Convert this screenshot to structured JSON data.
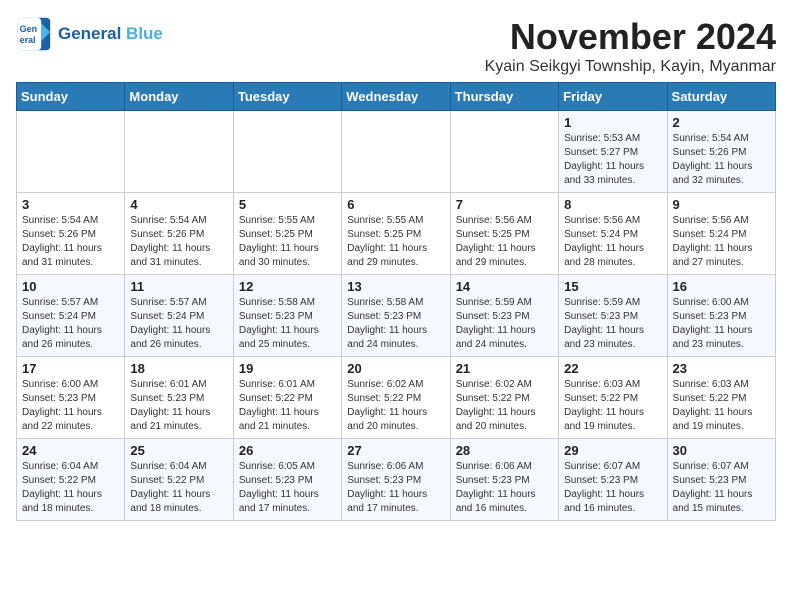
{
  "header": {
    "logo_line1": "General",
    "logo_line2": "Blue",
    "month_year": "November 2024",
    "location": "Kyain Seikgyi Township, Kayin, Myanmar"
  },
  "weekdays": [
    "Sunday",
    "Monday",
    "Tuesday",
    "Wednesday",
    "Thursday",
    "Friday",
    "Saturday"
  ],
  "weeks": [
    [
      {
        "day": "",
        "sunrise": "",
        "sunset": "",
        "daylight": ""
      },
      {
        "day": "",
        "sunrise": "",
        "sunset": "",
        "daylight": ""
      },
      {
        "day": "",
        "sunrise": "",
        "sunset": "",
        "daylight": ""
      },
      {
        "day": "",
        "sunrise": "",
        "sunset": "",
        "daylight": ""
      },
      {
        "day": "",
        "sunrise": "",
        "sunset": "",
        "daylight": ""
      },
      {
        "day": "1",
        "sunrise": "Sunrise: 5:53 AM",
        "sunset": "Sunset: 5:27 PM",
        "daylight": "Daylight: 11 hours and 33 minutes."
      },
      {
        "day": "2",
        "sunrise": "Sunrise: 5:54 AM",
        "sunset": "Sunset: 5:26 PM",
        "daylight": "Daylight: 11 hours and 32 minutes."
      }
    ],
    [
      {
        "day": "3",
        "sunrise": "Sunrise: 5:54 AM",
        "sunset": "Sunset: 5:26 PM",
        "daylight": "Daylight: 11 hours and 31 minutes."
      },
      {
        "day": "4",
        "sunrise": "Sunrise: 5:54 AM",
        "sunset": "Sunset: 5:26 PM",
        "daylight": "Daylight: 11 hours and 31 minutes."
      },
      {
        "day": "5",
        "sunrise": "Sunrise: 5:55 AM",
        "sunset": "Sunset: 5:25 PM",
        "daylight": "Daylight: 11 hours and 30 minutes."
      },
      {
        "day": "6",
        "sunrise": "Sunrise: 5:55 AM",
        "sunset": "Sunset: 5:25 PM",
        "daylight": "Daylight: 11 hours and 29 minutes."
      },
      {
        "day": "7",
        "sunrise": "Sunrise: 5:56 AM",
        "sunset": "Sunset: 5:25 PM",
        "daylight": "Daylight: 11 hours and 29 minutes."
      },
      {
        "day": "8",
        "sunrise": "Sunrise: 5:56 AM",
        "sunset": "Sunset: 5:24 PM",
        "daylight": "Daylight: 11 hours and 28 minutes."
      },
      {
        "day": "9",
        "sunrise": "Sunrise: 5:56 AM",
        "sunset": "Sunset: 5:24 PM",
        "daylight": "Daylight: 11 hours and 27 minutes."
      }
    ],
    [
      {
        "day": "10",
        "sunrise": "Sunrise: 5:57 AM",
        "sunset": "Sunset: 5:24 PM",
        "daylight": "Daylight: 11 hours and 26 minutes."
      },
      {
        "day": "11",
        "sunrise": "Sunrise: 5:57 AM",
        "sunset": "Sunset: 5:24 PM",
        "daylight": "Daylight: 11 hours and 26 minutes."
      },
      {
        "day": "12",
        "sunrise": "Sunrise: 5:58 AM",
        "sunset": "Sunset: 5:23 PM",
        "daylight": "Daylight: 11 hours and 25 minutes."
      },
      {
        "day": "13",
        "sunrise": "Sunrise: 5:58 AM",
        "sunset": "Sunset: 5:23 PM",
        "daylight": "Daylight: 11 hours and 24 minutes."
      },
      {
        "day": "14",
        "sunrise": "Sunrise: 5:59 AM",
        "sunset": "Sunset: 5:23 PM",
        "daylight": "Daylight: 11 hours and 24 minutes."
      },
      {
        "day": "15",
        "sunrise": "Sunrise: 5:59 AM",
        "sunset": "Sunset: 5:23 PM",
        "daylight": "Daylight: 11 hours and 23 minutes."
      },
      {
        "day": "16",
        "sunrise": "Sunrise: 6:00 AM",
        "sunset": "Sunset: 5:23 PM",
        "daylight": "Daylight: 11 hours and 23 minutes."
      }
    ],
    [
      {
        "day": "17",
        "sunrise": "Sunrise: 6:00 AM",
        "sunset": "Sunset: 5:23 PM",
        "daylight": "Daylight: 11 hours and 22 minutes."
      },
      {
        "day": "18",
        "sunrise": "Sunrise: 6:01 AM",
        "sunset": "Sunset: 5:23 PM",
        "daylight": "Daylight: 11 hours and 21 minutes."
      },
      {
        "day": "19",
        "sunrise": "Sunrise: 6:01 AM",
        "sunset": "Sunset: 5:22 PM",
        "daylight": "Daylight: 11 hours and 21 minutes."
      },
      {
        "day": "20",
        "sunrise": "Sunrise: 6:02 AM",
        "sunset": "Sunset: 5:22 PM",
        "daylight": "Daylight: 11 hours and 20 minutes."
      },
      {
        "day": "21",
        "sunrise": "Sunrise: 6:02 AM",
        "sunset": "Sunset: 5:22 PM",
        "daylight": "Daylight: 11 hours and 20 minutes."
      },
      {
        "day": "22",
        "sunrise": "Sunrise: 6:03 AM",
        "sunset": "Sunset: 5:22 PM",
        "daylight": "Daylight: 11 hours and 19 minutes."
      },
      {
        "day": "23",
        "sunrise": "Sunrise: 6:03 AM",
        "sunset": "Sunset: 5:22 PM",
        "daylight": "Daylight: 11 hours and 19 minutes."
      }
    ],
    [
      {
        "day": "24",
        "sunrise": "Sunrise: 6:04 AM",
        "sunset": "Sunset: 5:22 PM",
        "daylight": "Daylight: 11 hours and 18 minutes."
      },
      {
        "day": "25",
        "sunrise": "Sunrise: 6:04 AM",
        "sunset": "Sunset: 5:22 PM",
        "daylight": "Daylight: 11 hours and 18 minutes."
      },
      {
        "day": "26",
        "sunrise": "Sunrise: 6:05 AM",
        "sunset": "Sunset: 5:23 PM",
        "daylight": "Daylight: 11 hours and 17 minutes."
      },
      {
        "day": "27",
        "sunrise": "Sunrise: 6:06 AM",
        "sunset": "Sunset: 5:23 PM",
        "daylight": "Daylight: 11 hours and 17 minutes."
      },
      {
        "day": "28",
        "sunrise": "Sunrise: 6:06 AM",
        "sunset": "Sunset: 5:23 PM",
        "daylight": "Daylight: 11 hours and 16 minutes."
      },
      {
        "day": "29",
        "sunrise": "Sunrise: 6:07 AM",
        "sunset": "Sunset: 5:23 PM",
        "daylight": "Daylight: 11 hours and 16 minutes."
      },
      {
        "day": "30",
        "sunrise": "Sunrise: 6:07 AM",
        "sunset": "Sunset: 5:23 PM",
        "daylight": "Daylight: 11 hours and 15 minutes."
      }
    ]
  ]
}
